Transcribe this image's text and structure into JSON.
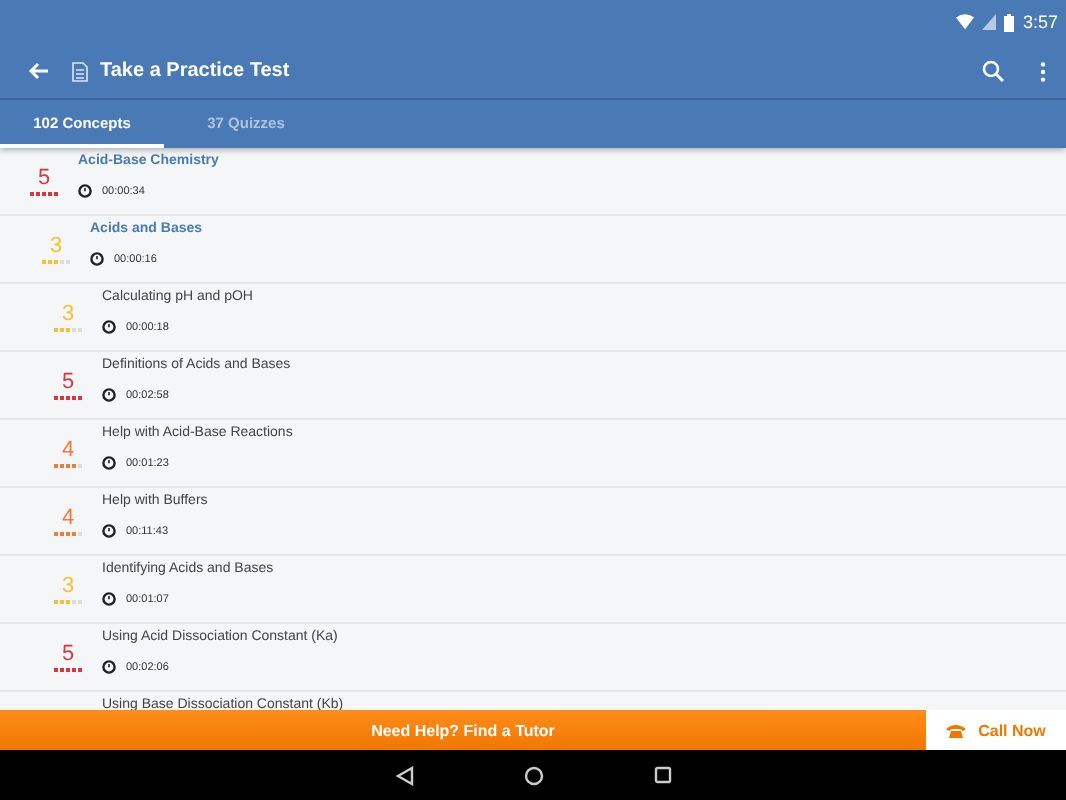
{
  "status_bar": {
    "time": "3:57"
  },
  "toolbar": {
    "title": "Take a Practice Test"
  },
  "tabs": [
    {
      "label": "102 Concepts",
      "selected": true
    },
    {
      "label": "37 Quizzes",
      "selected": false
    }
  ],
  "concepts": [
    {
      "title": "Acid-Base Chemistry",
      "score": "5",
      "stars": 5,
      "time": "00:00:34",
      "children": [
        {
          "title": "Acids and Bases",
          "score": "3",
          "stars": 3,
          "time": "00:00:16",
          "children": [
            {
              "title": "Calculating pH and pOH",
              "score": "3",
              "stars": 3,
              "time": "00:00:18"
            },
            {
              "title": "Definitions of Acids and Bases",
              "score": "5",
              "stars": 5,
              "time": "00:02:58"
            },
            {
              "title": "Help with Acid-Base Reactions",
              "score": "4",
              "stars": 4,
              "time": "00:01:23"
            },
            {
              "title": "Help with Buffers",
              "score": "4",
              "stars": 4,
              "time": "00:11:43"
            },
            {
              "title": "Identifying Acids and Bases",
              "score": "3",
              "stars": 3,
              "time": "00:01:07"
            },
            {
              "title": "Using Acid Dissociation Constant (Ka)",
              "score": "5",
              "stars": 5,
              "time": "00:02:06"
            },
            {
              "title": "Using Base Dissociation Constant (Kb)"
            }
          ]
        }
      ]
    }
  ],
  "tutor_bar": {
    "label": "Need Help? Find a Tutor",
    "call": "Call Now"
  }
}
